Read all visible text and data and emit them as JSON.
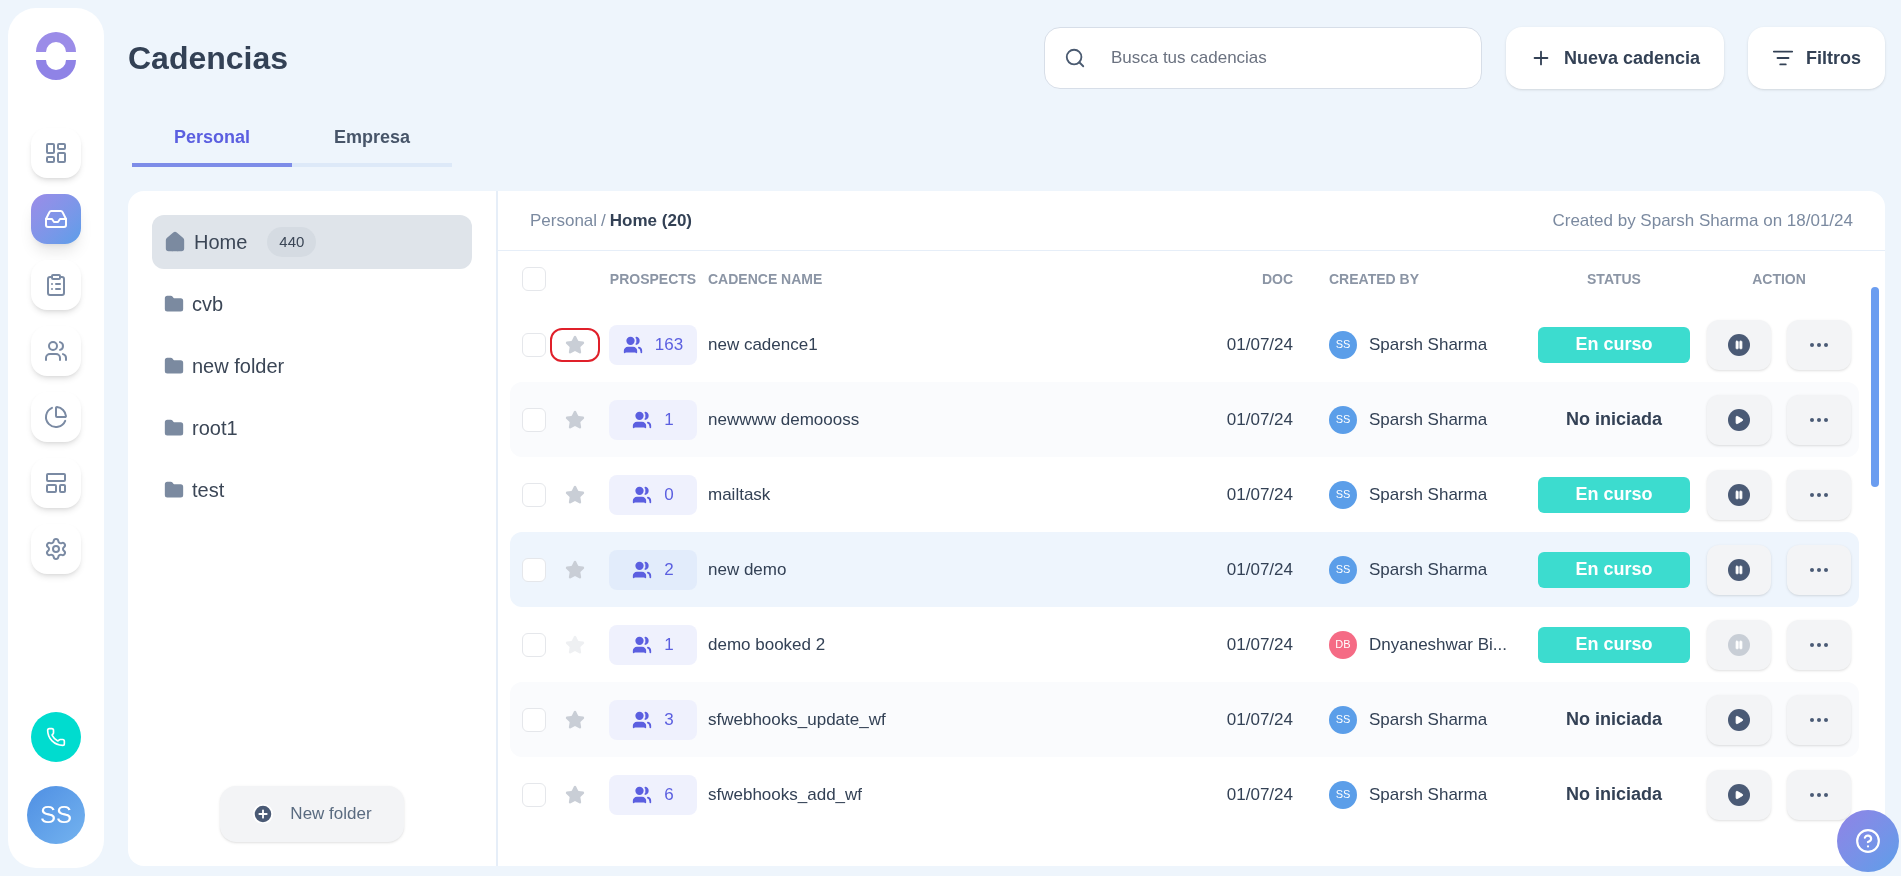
{
  "page": {
    "title": "Cadencias"
  },
  "search": {
    "placeholder": "Busca tus cadencias"
  },
  "header_buttons": [
    {
      "kind": "new",
      "label": "Nueva cadencia"
    },
    {
      "kind": "filter",
      "label": "Filtros"
    }
  ],
  "nav": [
    {
      "kind": "dashboard",
      "selected": false
    },
    {
      "kind": "cadences",
      "selected": true
    },
    {
      "kind": "tasks",
      "selected": false
    },
    {
      "kind": "people",
      "selected": false
    },
    {
      "kind": "reports",
      "selected": false
    },
    {
      "kind": "templates",
      "selected": false
    },
    {
      "kind": "settings",
      "selected": false
    }
  ],
  "user": {
    "initials": "SS"
  },
  "tabs": [
    {
      "label": "Personal",
      "selected": true
    },
    {
      "label": "Empresa",
      "selected": false
    }
  ],
  "folders": [
    {
      "kind": "home",
      "name": "Home",
      "count": "440",
      "selected": true
    },
    {
      "kind": "folder",
      "name": "cvb",
      "selected": false
    },
    {
      "kind": "folder",
      "name": "new folder",
      "selected": false
    },
    {
      "kind": "folder",
      "name": "root1",
      "selected": false
    },
    {
      "kind": "folder",
      "name": "test",
      "selected": false
    }
  ],
  "new_folder_button": {
    "label": "New folder"
  },
  "breadcrumb": {
    "parent": "Personal",
    "separator": "/",
    "current": "Home (20)"
  },
  "created_info": "Created by Sparsh Sharma on 18/01/24",
  "table": {
    "select_all": {
      "checked": false
    },
    "columns": [
      "PROSPECTS",
      "CADENCE NAME",
      "DOC",
      "CREATED BY",
      "STATUS",
      "ACTION"
    ],
    "rows": [
      {
        "checked": false,
        "prospects": "163",
        "name": "new cadence1",
        "doc": "01/07/24",
        "initials": "SS",
        "color": "#5b9ee9",
        "creator": "Sparsh Sharma",
        "status": "En curso",
        "running": true,
        "action_disabled": false,
        "star_disabled": false,
        "star_outlined": true,
        "selected": false
      },
      {
        "checked": false,
        "prospects": "1",
        "name": "newwww demoooss",
        "doc": "01/07/24",
        "initials": "SS",
        "color": "#5b9ee9",
        "creator": "Sparsh Sharma",
        "status": "No iniciada",
        "running": false,
        "action_disabled": false,
        "star_disabled": false,
        "star_outlined": false,
        "selected": false
      },
      {
        "checked": false,
        "prospects": "0",
        "name": "mailtask",
        "doc": "01/07/24",
        "initials": "SS",
        "color": "#5b9ee9",
        "creator": "Sparsh Sharma",
        "status": "En curso",
        "running": true,
        "action_disabled": false,
        "star_disabled": false,
        "star_outlined": false,
        "selected": false
      },
      {
        "checked": false,
        "prospects": "2",
        "name": "new demo",
        "doc": "01/07/24",
        "initials": "SS",
        "color": "#5b9ee9",
        "creator": "Sparsh Sharma",
        "status": "En curso",
        "running": true,
        "action_disabled": false,
        "star_disabled": false,
        "star_outlined": false,
        "selected": true
      },
      {
        "checked": false,
        "prospects": "1",
        "name": "demo booked 2",
        "doc": "01/07/24",
        "initials": "DB",
        "color": "#f56b85",
        "creator": "Dnyaneshwar Bi...",
        "status": "En curso",
        "running": true,
        "action_disabled": true,
        "star_disabled": true,
        "star_outlined": false,
        "selected": false
      },
      {
        "checked": false,
        "prospects": "3",
        "name": "sfwebhooks_update_wf",
        "doc": "01/07/24",
        "initials": "SS",
        "color": "#5b9ee9",
        "creator": "Sparsh Sharma",
        "status": "No iniciada",
        "running": false,
        "action_disabled": false,
        "star_disabled": false,
        "star_outlined": false,
        "selected": false
      },
      {
        "checked": false,
        "prospects": "6",
        "name": "sfwebhooks_add_wf",
        "doc": "01/07/24",
        "initials": "SS",
        "color": "#5b9ee9",
        "creator": "Sparsh Sharma",
        "status": "No iniciada",
        "running": false,
        "action_disabled": false,
        "star_disabled": false,
        "star_outlined": false,
        "selected": false
      }
    ]
  }
}
